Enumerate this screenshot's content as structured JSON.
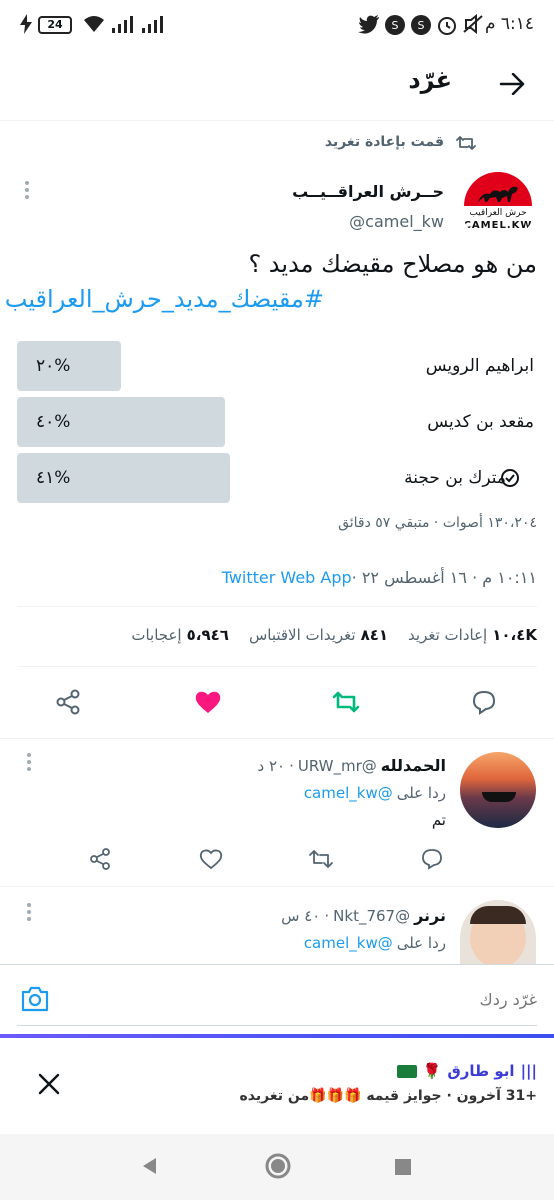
{
  "status_bar": {
    "time": "٦:١٤ م",
    "battery": "24"
  },
  "header": {
    "title": "غرّد"
  },
  "retweet": {
    "label": "قمت بإعادة تغريد"
  },
  "tweet": {
    "author_name": "حــرش العراقــيــب",
    "handle": "@camel_kw",
    "avatar_text": "حرش العراقيب",
    "avatar_brand": "CAMEL.KW",
    "text": "من هو مصلاح مقيضك مديد ؟",
    "hashtag": "#مقيضك_مديد_حرش_العراقيب",
    "poll": {
      "options": [
        {
          "label": "ابراهيم الرويس",
          "percent": "٢٠%",
          "value": 0.2
        },
        {
          "label": "مقعد بن كديس",
          "percent": "٤٠%",
          "value": 0.4
        },
        {
          "label": "مترك بن حجنة",
          "percent": "٤١%",
          "value": 0.41,
          "selected": true
        }
      ],
      "meta": "١٣٠،٢٠٤ أصوات · متبقي ٥٧ دقائق"
    },
    "timestamp": "١٠:١١ م · ١٦ أغسطس ٢٢ · ",
    "source": "Twitter Web App",
    "stats": {
      "retweets_num": "١٠،٤K",
      "retweets_label": "إعادات تغريد",
      "quotes_num": "٨٤١",
      "quotes_label": "تغريدات الاقتباس",
      "likes_num": "٥،٩٤٦",
      "likes_label": "إعجابات"
    }
  },
  "replies": [
    {
      "name": "الحمدلله",
      "handle": "@URW_mr",
      "time": "٢٠ د",
      "replying_prefix": "ردا على",
      "replying_to": "@camel_kw",
      "text": "تم"
    },
    {
      "name": "نرنر",
      "handle": "@Nkt_767",
      "time": "٤٠ س",
      "replying_prefix": "ردا على",
      "replying_to": "@camel_kw",
      "text": ""
    }
  ],
  "compose": {
    "placeholder": "غرّد ردك"
  },
  "notification": {
    "name": "ابو طارق",
    "text": "+31 آخرون · جوايز قيمه 🎁🎁🎁من تغريده"
  },
  "colors": {
    "accent": "#1d9bf0",
    "like": "#f91880",
    "retweet": "#00ba7c"
  }
}
